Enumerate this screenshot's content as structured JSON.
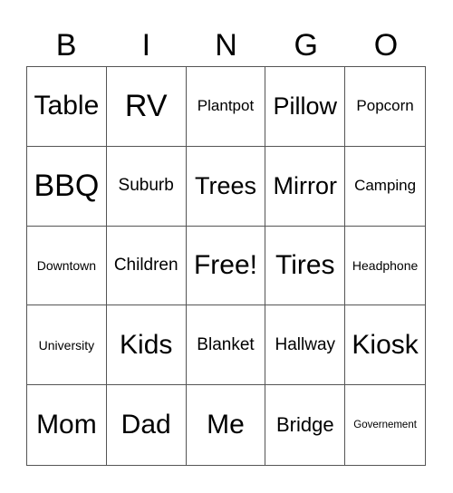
{
  "header": [
    "B",
    "I",
    "N",
    "G",
    "O"
  ],
  "cells": [
    [
      "Table",
      "RV",
      "Plantpot",
      "Pillow",
      "Popcorn"
    ],
    [
      "BBQ",
      "Suburb",
      "Trees",
      "Mirror",
      "Camping"
    ],
    [
      "Downtown",
      "Children",
      "Free!",
      "Tires",
      "Headphone"
    ],
    [
      "University",
      "Kids",
      "Blanket",
      "Hallway",
      "Kiosk"
    ],
    [
      "Mom",
      "Dad",
      "Me",
      "Bridge",
      "Governement"
    ]
  ]
}
